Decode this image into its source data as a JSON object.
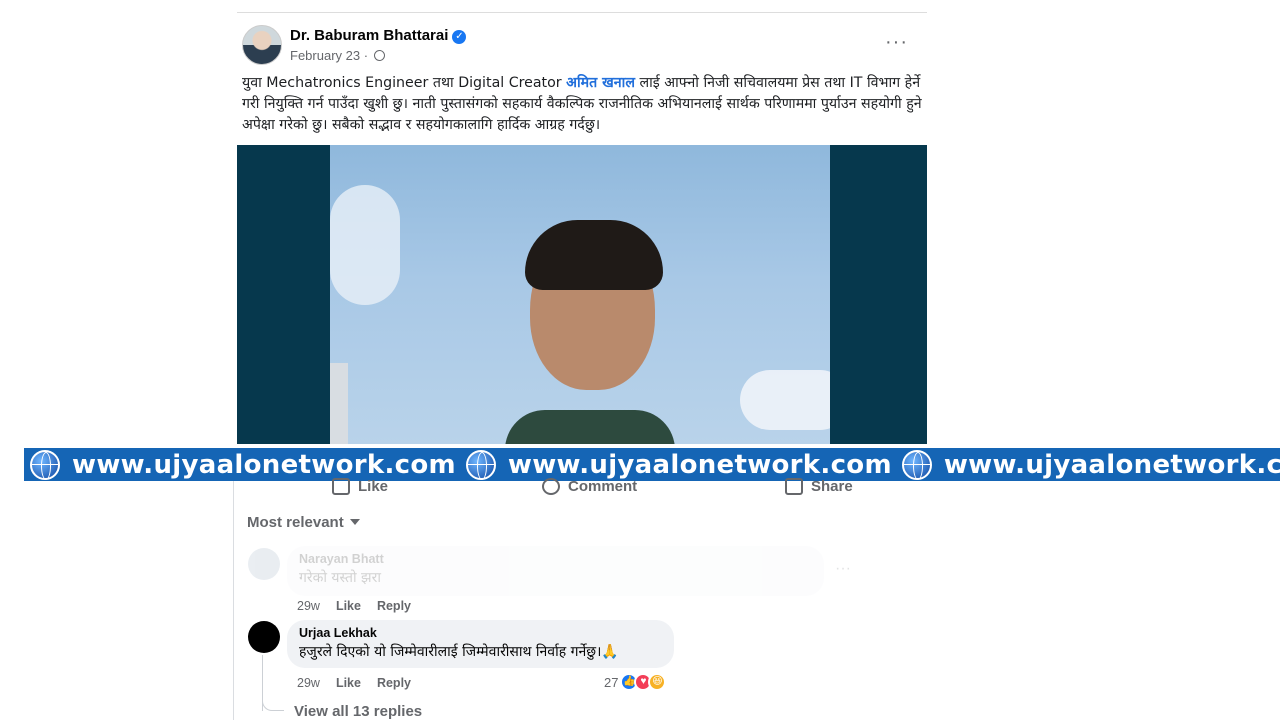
{
  "post": {
    "author": "Dr. Baburam Bhattarai",
    "date": "February 23",
    "date_sep": " · ",
    "more_label": "···",
    "text_before": "युवा Mechatronics Engineer तथा Digital Creator ",
    "mention": "अमित खनाल",
    "text_after": " लाई आफ्नो निजी सचिवालयमा प्रेस तथा IT विभाग हेर्ने गरी नियुक्ति गर्न पाउँदा खुशी छु। नाती पुस्तासंगको सहकार्य वैकल्पिक राजनीतिक अभियानलाई सार्थक परिणाममा पुर्याउन सहयोगी हुने अपेक्षा गरेको छु। सबैको सद्भाव र सहयोगकालागि हार्दिक आग्रह गर्दछु।"
  },
  "banner": {
    "items": [
      "www.ujyaalonetwork.com",
      "www.ujyaalonetwork.com",
      "www.ujyaalonetwork.com"
    ]
  },
  "actions": {
    "like": "Like",
    "comment": "Comment",
    "share": "Share"
  },
  "comments": {
    "sort_label": "Most relevant",
    "list": [
      {
        "name": "Narayan Bhatt",
        "text": "गरेको यस्तो झरा",
        "time": "29w",
        "like": "Like",
        "reply": "Reply",
        "more": "···"
      },
      {
        "name": "Urjaa Lekhak",
        "text": "हजुरले दिएको यो जिम्मेवारीलाई जिम्मेवारीसाथ निर्वाह गर्नेछु।🙏",
        "time": "29w",
        "like": "Like",
        "reply": "Reply",
        "reaction_count": "27"
      }
    ],
    "view_replies": "View all 13 replies"
  },
  "colors": {
    "accent": "#1877f2",
    "banner": "#1565b5",
    "photo_bg": "#06384d"
  }
}
